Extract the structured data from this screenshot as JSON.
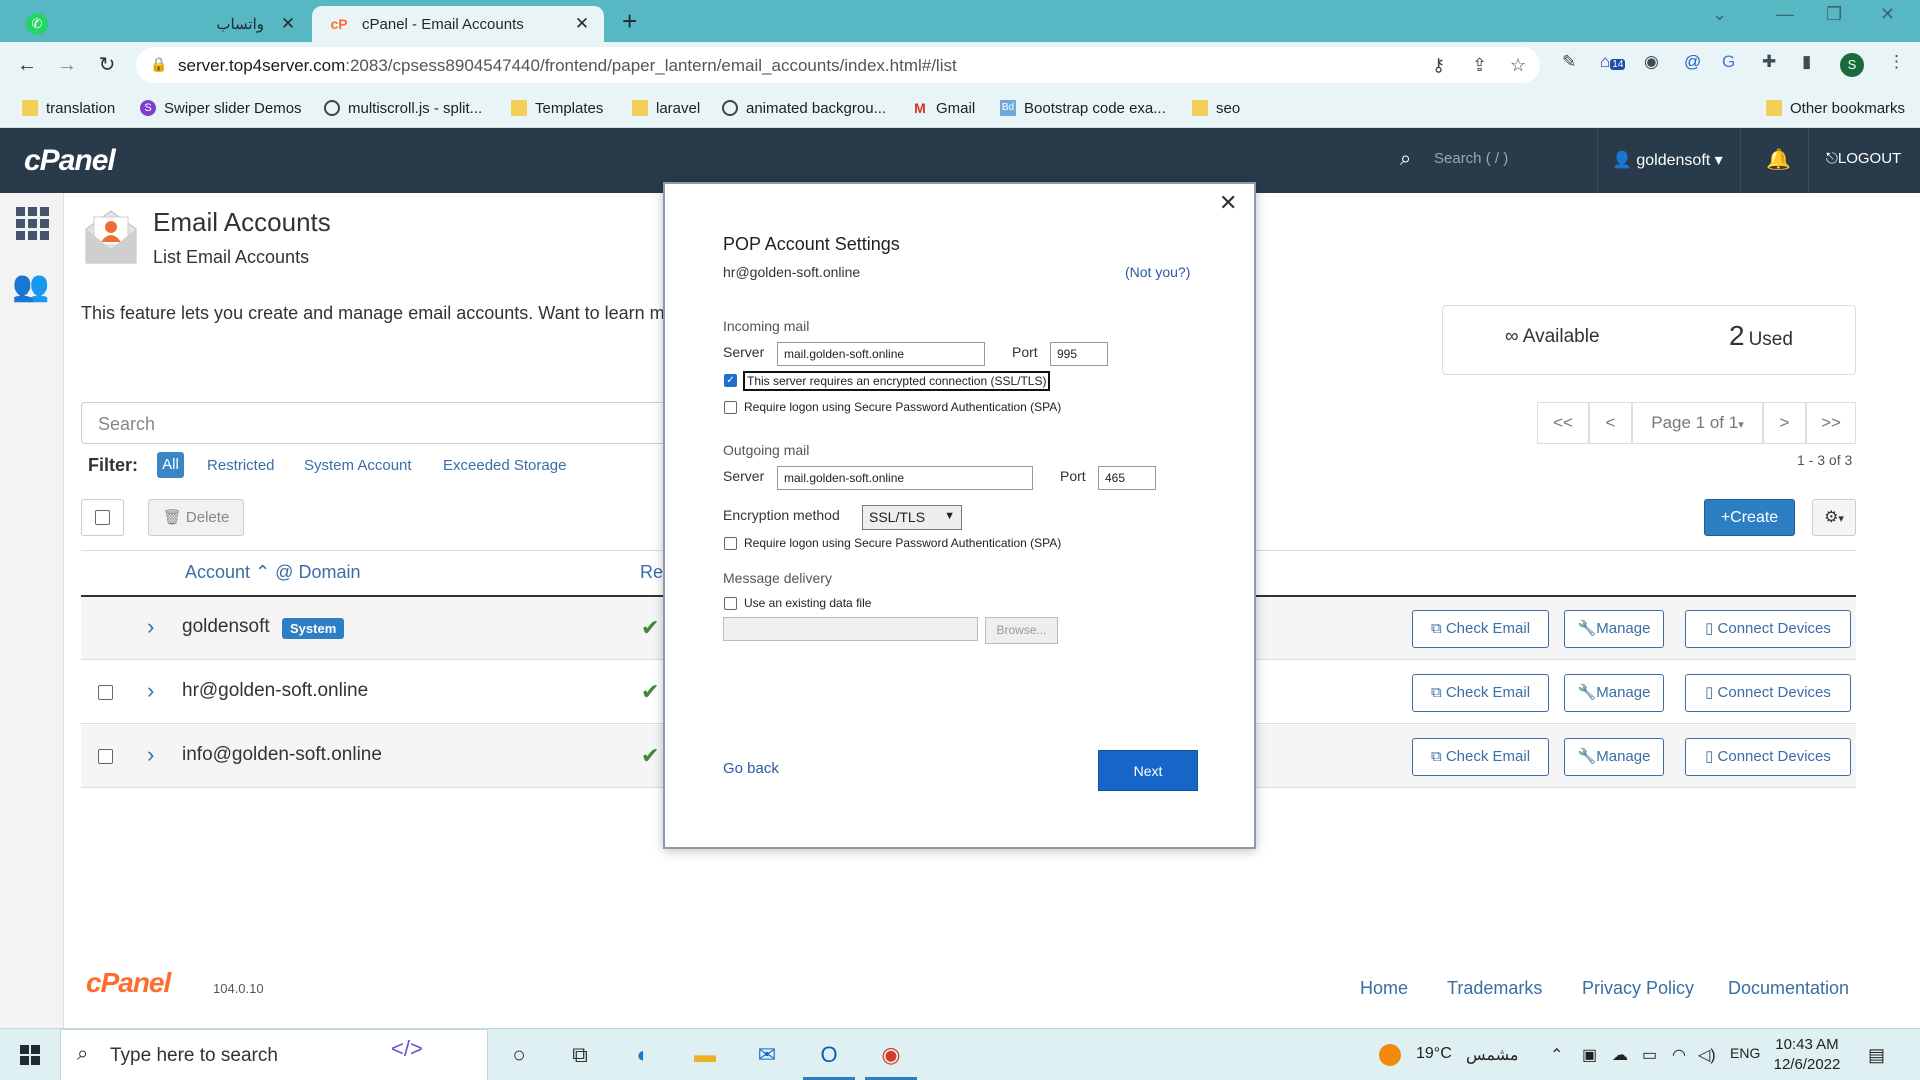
{
  "browser": {
    "tabs": [
      {
        "label": "واتساب"
      },
      {
        "label": "cPanel - Email Accounts"
      }
    ],
    "url_host": "server.top4server.com",
    "url_rest": ":2083/cpsess8904547440/frontend/paper_lantern/email_accounts/index.html#/list",
    "profile_initial": "S",
    "extension_badge": "14",
    "bookmarks": [
      {
        "label": "translation",
        "icon": "folder"
      },
      {
        "label": "Swiper slider Demos",
        "icon": "swiper"
      },
      {
        "label": "multiscroll.js - split...",
        "icon": "globe"
      },
      {
        "label": "Templates",
        "icon": "folder"
      },
      {
        "label": "laravel",
        "icon": "folder"
      },
      {
        "label": "animated backgrou...",
        "icon": "globe"
      },
      {
        "label": "Gmail",
        "icon": "gmail"
      },
      {
        "label": "Bootstrap code exa...",
        "icon": "bootstrap"
      },
      {
        "label": "seo",
        "icon": "folder"
      }
    ],
    "other_bookmarks": "Other bookmarks"
  },
  "cpanel": {
    "logo": "cPanel",
    "search_placeholder": "Search ( / )",
    "user": "goldensoft",
    "logout": "LOGOUT"
  },
  "page": {
    "title": "Email Accounts",
    "subtitle": "List Email Accounts",
    "description": "This feature lets you create and manage email accounts. Want to learn m",
    "stats": {
      "available_symbol": "∞",
      "available_label": "Available",
      "used_count": "2",
      "used_label": "Used"
    },
    "search_placeholder": "Search",
    "pager": {
      "first": "<<",
      "prev": "<",
      "page": "Page 1 of 1",
      "next": ">",
      "last": ">>",
      "count": "1 - 3 of 3"
    },
    "filter": {
      "label": "Filter:",
      "options": [
        "All",
        "Restricted",
        "System Account",
        "Exceeded Storage"
      ]
    },
    "delete_label": "Delete",
    "create_label": "Create",
    "columns": {
      "account": "Account",
      "domain": "@ Domain",
      "restrictions": "Re"
    },
    "rows": [
      {
        "account": "goldensoft",
        "badge": "System"
      },
      {
        "account": "hr@golden-soft.online",
        "badge": ""
      },
      {
        "account": "info@golden-soft.online",
        "badge": ""
      }
    ],
    "row_actions": {
      "check_email": "Check Email",
      "manage": "Manage",
      "connect": "Connect Devices"
    },
    "footer": {
      "logo": "cPanel",
      "version": "104.0.10",
      "links": [
        "Home",
        "Trademarks",
        "Privacy Policy",
        "Documentation"
      ]
    }
  },
  "modal": {
    "title": "POP Account Settings",
    "email": "hr@golden-soft.online",
    "not_you": "(Not you?)",
    "incoming": {
      "heading": "Incoming mail",
      "server_label": "Server",
      "server": "mail.golden-soft.online",
      "port_label": "Port",
      "port": "995",
      "ssl_label": "This server requires an encrypted connection (SSL/TLS)",
      "ssl_checked": true,
      "spa_label": "Require logon using Secure Password Authentication (SPA)"
    },
    "outgoing": {
      "heading": "Outgoing mail",
      "server_label": "Server",
      "server": "mail.golden-soft.online",
      "port_label": "Port",
      "port": "465",
      "encryption_label": "Encryption method",
      "encryption": "SSL/TLS",
      "spa_label": "Require logon using Secure Password Authentication (SPA)"
    },
    "delivery": {
      "heading": "Message delivery",
      "existing_label": "Use an existing data file",
      "browse": "Browse..."
    },
    "back": "Go back",
    "next": "Next"
  },
  "taskbar": {
    "search_placeholder": "Type here to search",
    "weather_temp": "19°C",
    "weather_text": "مشمس",
    "language": "ENG",
    "time": "10:43 AM",
    "date": "12/6/2022"
  }
}
